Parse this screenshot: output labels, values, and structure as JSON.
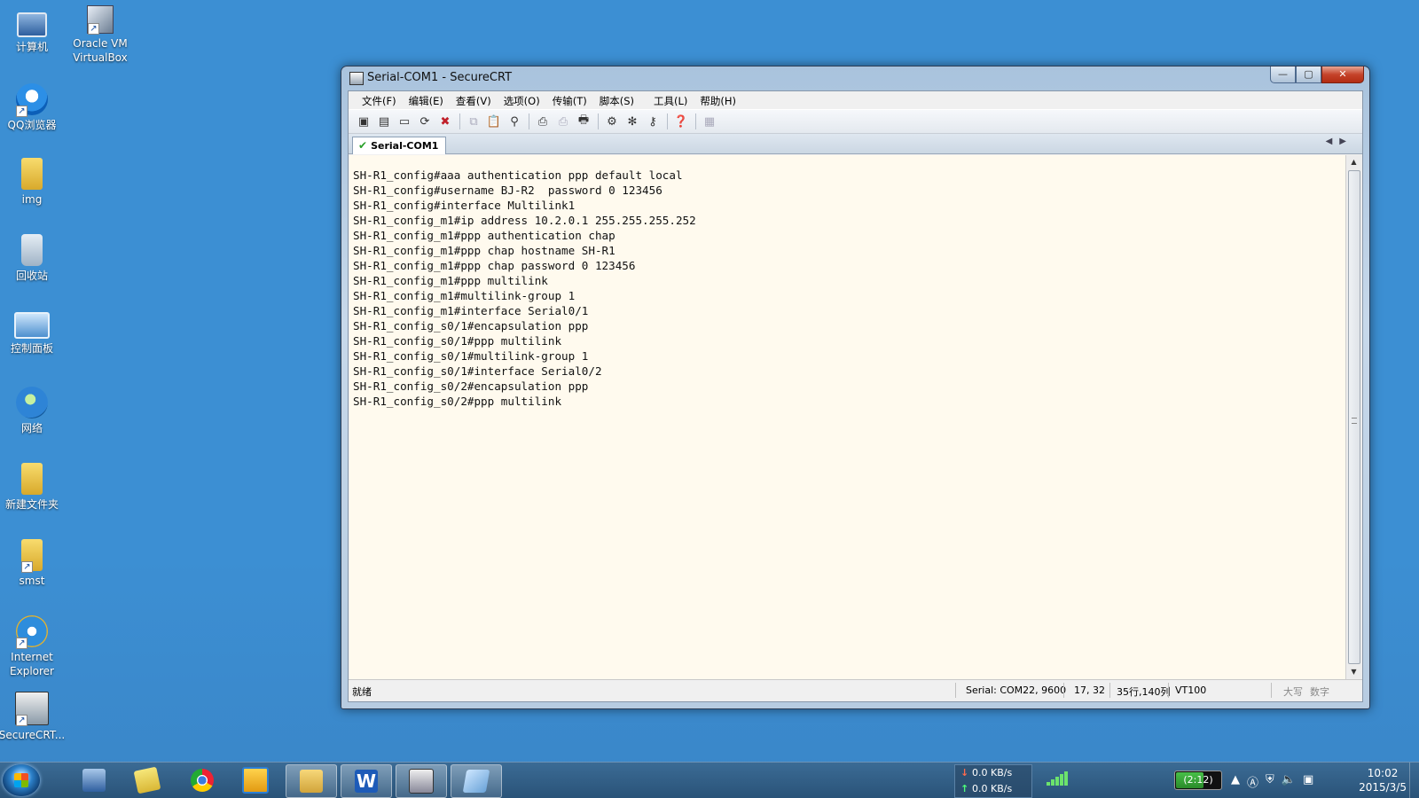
{
  "desktop": {
    "icons": [
      {
        "label": "计算机"
      },
      {
        "label": "Oracle VM VirtualBox"
      },
      {
        "label": "QQ浏览器"
      },
      {
        "label": "img"
      },
      {
        "label": "回收站"
      },
      {
        "label": "控制面板"
      },
      {
        "label": "网络"
      },
      {
        "label": "新建文件夹"
      },
      {
        "label": "smst"
      },
      {
        "label": "Internet Explorer"
      },
      {
        "label": "SecureCRT..."
      }
    ]
  },
  "window": {
    "title": "Serial-COM1 - SecureCRT",
    "buttons": {
      "minimize": "—",
      "maximize": "▢",
      "close": "✕"
    },
    "menu": [
      "文件(F)",
      "编辑(E)",
      "查看(V)",
      "选项(O)",
      "传输(T)",
      "脚本(S)",
      "工具(L)",
      "帮助(H)"
    ],
    "tab": {
      "label": "Serial-COM1",
      "status_icon": "check-icon"
    },
    "terminal_lines": [
      "SH-R1_config#aaa authentication ppp default local",
      "SH-R1_config#username BJ-R2  password 0 123456",
      "SH-R1_config#interface Multilink1",
      "SH-R1_config_m1#ip address 10.2.0.1 255.255.255.252",
      "SH-R1_config_m1#ppp authentication chap",
      "SH-R1_config_m1#ppp chap hostname SH-R1",
      "SH-R1_config_m1#ppp chap password 0 123456",
      "SH-R1_config_m1#ppp multilink",
      "SH-R1_config_m1#multilink-group 1",
      "SH-R1_config_m1#interface Serial0/1",
      "SH-R1_config_s0/1#encapsulation ppp",
      "SH-R1_config_s0/1#ppp multilink",
      "SH-R1_config_s0/1#multilink-group 1",
      "SH-R1_config_s0/1#interface Serial0/2",
      "SH-R1_config_s0/2#encapsulation ppp",
      "SH-R1_config_s0/2#ppp multilink"
    ],
    "status": {
      "ready": "就绪",
      "connection": "Serial: COM22, 9600",
      "cursor": "17,  32",
      "size": "35行,140列",
      "emulation": "VT100",
      "caps": "大写",
      "num": "数字"
    }
  },
  "taskbar": {
    "net_down": "0.0 KB/s",
    "net_up": "0.0 KB/s",
    "battery": "(2:12)",
    "time": "10:02",
    "date": "2015/3/5"
  }
}
